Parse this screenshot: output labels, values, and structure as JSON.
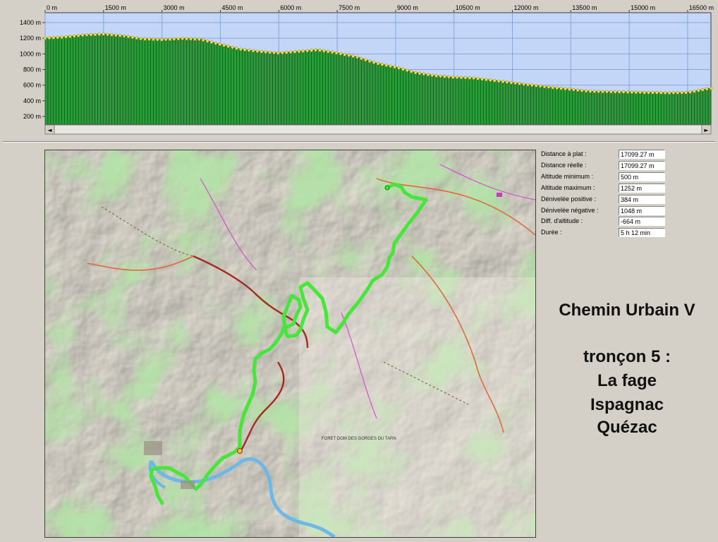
{
  "profile": {
    "x_ticks": [
      "0 m",
      "1500 m",
      "3000 m",
      "4500 m",
      "6000 m",
      "7500 m",
      "9000 m",
      "10500 m",
      "12000 m",
      "13500 m",
      "15000 m",
      "16500 m"
    ],
    "y_ticks": [
      "1400 m",
      "1200 m",
      "1000 m",
      "800 m",
      "600 m",
      "400 m",
      "200 m"
    ],
    "scroll_left": "◄",
    "scroll_right": "►",
    "colors": {
      "sky": "#c4d6f7",
      "terrain": "#2b9a3a",
      "points": "#f2e64a",
      "grid": "#8aa6d8"
    }
  },
  "chart_data": {
    "type": "area",
    "xlabel": "",
    "ylabel": "",
    "xlim": [
      0,
      17099
    ],
    "ylim": [
      0,
      1500
    ],
    "x": [
      0,
      500,
      1000,
      1500,
      2000,
      2500,
      3000,
      3500,
      4000,
      4500,
      5000,
      5500,
      6000,
      6500,
      7000,
      7500,
      8000,
      8500,
      9000,
      9500,
      10000,
      10500,
      11000,
      11500,
      12000,
      12500,
      13000,
      13500,
      14000,
      14500,
      15000,
      15500,
      16000,
      16500,
      17099
    ],
    "series": [
      {
        "values": [
          1200,
          1215,
          1240,
          1252,
          1230,
          1190,
          1180,
          1195,
          1185,
          1120,
          1060,
          1030,
          1010,
          1030,
          1050,
          1010,
          960,
          880,
          830,
          760,
          720,
          700,
          690,
          660,
          630,
          600,
          570,
          545,
          520,
          515,
          510,
          505,
          500,
          505,
          560
        ]
      }
    ]
  },
  "stats": [
    {
      "label": "Distance à plat :",
      "value": "17099.27 m"
    },
    {
      "label": "Distance réelle :",
      "value": "17099.27 m"
    },
    {
      "label": "Altitude minimum :",
      "value": "500 m"
    },
    {
      "label": "Altitude maximum :",
      "value": "1252 m"
    },
    {
      "label": "Dénivelée positive :",
      "value": "384 m"
    },
    {
      "label": "Dénivelée négative :",
      "value": "1048 m"
    },
    {
      "label": "Diff. d'altitude :",
      "value": "-664 m"
    },
    {
      "label": "Durée :",
      "value": "5 h 12 min"
    }
  ],
  "title": {
    "line1": "Chemin Urbain V",
    "line2": "tronçon 5 :",
    "line3": "La fage",
    "line4": "Ispagnac",
    "line5": "Quézac"
  },
  "map": {
    "route_color": "#46e63a",
    "map_labels": [
      "FORET DOM DES GORGES DU TARN"
    ]
  }
}
